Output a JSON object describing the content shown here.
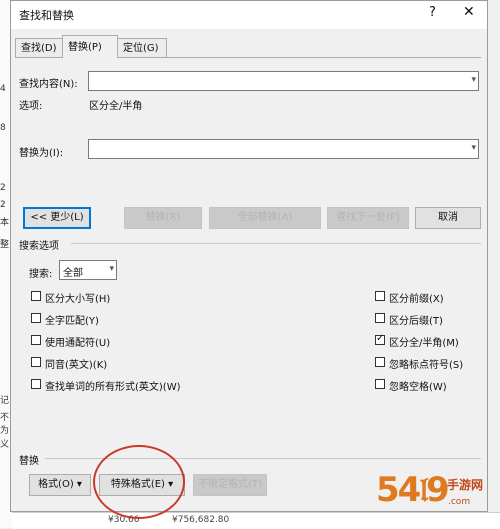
{
  "background_doc": {
    "left_fragments": [
      "4",
      "8",
      "2",
      "2",
      "本",
      "整",
      "记",
      "不",
      "为",
      "义"
    ],
    "bottom_values": [
      "¥30.66",
      "¥756,682.80"
    ]
  },
  "dialog": {
    "title": "查找和替换",
    "help_glyph": "?",
    "close_glyph": "✕",
    "tabs": [
      {
        "label": "查找(D)",
        "active": false
      },
      {
        "label": "替换(P)",
        "active": true
      },
      {
        "label": "定位(G)",
        "active": false
      }
    ],
    "find": {
      "label": "查找内容(N):",
      "value": ""
    },
    "options": {
      "label": "选项:",
      "value": "区分全/半角"
    },
    "replace": {
      "label": "替换为(I):",
      "value": ""
    },
    "buttons": {
      "less": "<< 更少(L)",
      "replace": "替换(R)",
      "replace_all": "全部替换(A)",
      "find_next": "查找下一处(F)",
      "cancel": "取消"
    },
    "search_options_title": "搜索选项",
    "search": {
      "label": "搜索:",
      "value": "全部"
    },
    "left_checks": [
      {
        "label": "区分大小写(H)",
        "checked": false
      },
      {
        "label": "全字匹配(Y)",
        "checked": false
      },
      {
        "label": "使用通配符(U)",
        "checked": false
      },
      {
        "label": "同音(英文)(K)",
        "checked": false
      },
      {
        "label": "查找单词的所有形式(英文)(W)",
        "checked": false
      }
    ],
    "right_checks": [
      {
        "label": "区分前缀(X)",
        "checked": false
      },
      {
        "label": "区分后缀(T)",
        "checked": false
      },
      {
        "label": "区分全/半角(M)",
        "checked": true
      },
      {
        "label": "忽略标点符号(S)",
        "checked": false
      },
      {
        "label": "忽略空格(W)",
        "checked": false
      }
    ],
    "replace_section_title": "替换",
    "bottom_buttons": {
      "format": "格式(O) ▾",
      "special": "特殊格式(E) ▾",
      "no_format": "不限定格式(T)"
    },
    "annotation_color": "#c8392b"
  },
  "watermark": {
    "logo": "54𝔩9",
    "title": "手游网",
    "url": ".com"
  }
}
